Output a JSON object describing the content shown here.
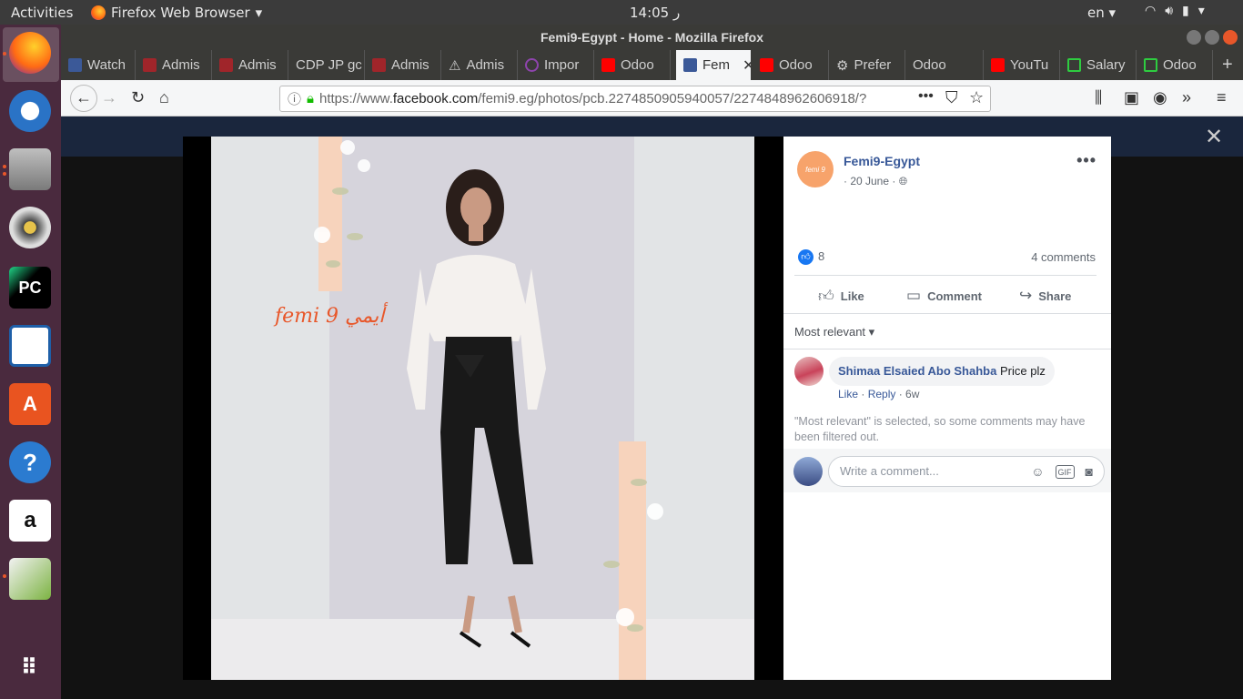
{
  "topbar": {
    "activities": "Activities",
    "app_menu": "Firefox Web Browser",
    "clock": "ر 14:05",
    "lang": "en"
  },
  "window": {
    "title": "Femi9-Egypt - Home - Mozilla Firefox"
  },
  "tabs": [
    {
      "label": "Watch",
      "favicon_color": "#3b5998"
    },
    {
      "label": "Admis",
      "favicon_color": "#a0252a"
    },
    {
      "label": "Admis",
      "favicon_color": "#a0252a"
    },
    {
      "label": "CDP JP gc",
      "favicon_color": ""
    },
    {
      "label": "Admis",
      "favicon_color": "#a0252a"
    },
    {
      "label": "Admis",
      "favicon_color": "#555555"
    },
    {
      "label": "Impor",
      "favicon_color": "#8e44ad"
    },
    {
      "label": "Odoo",
      "favicon_color": "#ff0000"
    },
    {
      "label": "Fem",
      "favicon_color": "#3b5998"
    },
    {
      "label": "Odoo",
      "favicon_color": "#ff0000"
    },
    {
      "label": "Prefer",
      "favicon_color": "#cccccc"
    },
    {
      "label": "Odoo",
      "favicon_color": ""
    },
    {
      "label": "YouTu",
      "favicon_color": "#ff0000"
    },
    {
      "label": "Salary",
      "favicon_color": "#2ecc40"
    },
    {
      "label": "Odoo",
      "favicon_color": "#2ecc40"
    }
  ],
  "url": {
    "prefix": "https://www.",
    "domain": "facebook.com",
    "path": "/femi9.eg/photos/pcb.2274850905940057/2274848962606918/?"
  },
  "post": {
    "page_name": "Femi9-Egypt",
    "avatar_text": "femi 9",
    "date": "· 20 June ·",
    "like_count": "8",
    "comments_count": "4 comments",
    "like_label": "Like",
    "comment_label": "Comment",
    "share_label": "Share",
    "sort_label": "Most relevant ▾"
  },
  "comment": {
    "author": "Shimaa Elsaied Abo Shahba",
    "text": "Price plz",
    "like": "Like",
    "reply": "Reply",
    "age": "6w"
  },
  "filter_note": "\"Most relevant\" is selected, so some comments may have been filtered out.",
  "write_placeholder": "Write a comment...",
  "photo_logo_text": "femi 9 أيمي",
  "colors": {
    "fb_blue": "#385898",
    "accent_orange": "#f7a36b",
    "dock_bg": "#4a2a3e"
  }
}
